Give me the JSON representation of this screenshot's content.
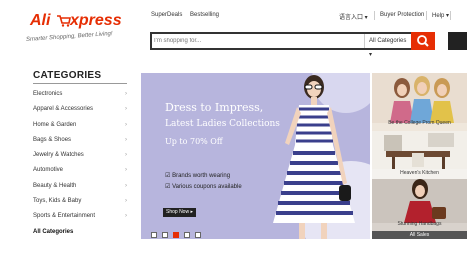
{
  "header": {
    "logo_ali": "Ali",
    "logo_express": "xpress",
    "tagline": "Smarter Shopping, Better Living!",
    "links": [
      "SuperDeals",
      "Bestselling"
    ],
    "language": "语言入口",
    "buyer_protection": "Buyer Protection",
    "help": "Help"
  },
  "search": {
    "placeholder": "I'm shopping for...",
    "category": "All Categories",
    "button_color": "#e62e04"
  },
  "categories": {
    "title": "CATEGORIES",
    "items": [
      "Electronics",
      "Apparel & Accessories",
      "Home & Garden",
      "Bags & Shoes",
      "Jewelry & Watches",
      "Automotive",
      "Beauty & Health",
      "Toys, Kids & Baby",
      "Sports & Entertainment"
    ],
    "all": "All Categories"
  },
  "banner": {
    "line1": "Dress to Impress,",
    "line2": "Latest Ladies Collections",
    "line3": "Up to 70% Off",
    "bullet1": "Brands worth wearing",
    "bullet2": "Various coupons available",
    "shop_now": "Shop Now ▸",
    "slides": 5,
    "active_slide": 3
  },
  "promos": {
    "items": [
      {
        "caption": "Be the College Prom Queen"
      },
      {
        "caption": "Heaven's Kitchen"
      },
      {
        "caption": "Stunning Handbags"
      }
    ],
    "all_sales": "All Sales"
  },
  "colors": {
    "brand": "#e62e04",
    "banner_bg": "#b7b5dd"
  }
}
